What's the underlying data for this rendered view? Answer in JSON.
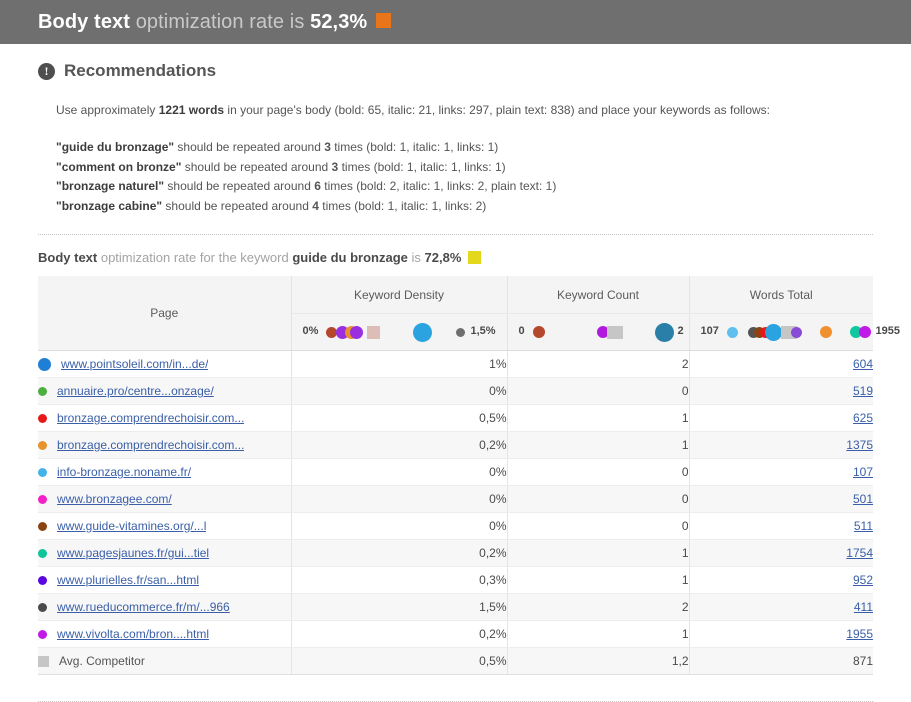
{
  "topbar": {
    "strong_1": "Body text",
    "muted_1": " optimization rate is ",
    "strong_2": "52,3%",
    "swatch_color": "#e8751a"
  },
  "recommendations": {
    "icon": "exclamation-circle-icon",
    "title": "Recommendations",
    "intro_parts": {
      "p1": "Use approximately ",
      "b1": "1221 words",
      "p2": " in your page's body (bold: 65, italic: 21, links: 297, plain text: 838) and place your keywords as follows:"
    },
    "items": [
      {
        "quote_open": "\"",
        "keyword": "guide du bronzage",
        "quote_close": "\"",
        "rest_1": " should be repeated around ",
        "count": "3",
        "rest_2": " times (bold: 1, italic: 1, links: 1)"
      },
      {
        "quote_open": "\"",
        "keyword": "comment on bronze",
        "quote_close": "\"",
        "rest_1": " should be repeated around ",
        "count": "3",
        "rest_2": " times (bold: 1, italic: 1, links: 1)"
      },
      {
        "quote_open": "\"",
        "keyword": "bronzage naturel",
        "quote_close": "\"",
        "rest_1": " should be repeated around ",
        "count": "6",
        "rest_2": " times (bold: 2, italic: 1, links: 2, plain text: 1)"
      },
      {
        "quote_open": "\"",
        "keyword": "bronzage cabine",
        "quote_close": "\"",
        "rest_1": " should be repeated around ",
        "count": "4",
        "rest_2": " times (bold: 1, italic: 1, links: 2)"
      }
    ]
  },
  "subheader": {
    "strong_1": "Body text",
    "muted_1": " optimization rate for the keyword ",
    "strong_2": "guide du bronzage",
    "muted_2": " is ",
    "strong_3": "72,8%",
    "swatch_color": "#e3d81b"
  },
  "table": {
    "headers": {
      "page": "Page",
      "keyword_density": "Keyword Density",
      "keyword_count": "Keyword Count",
      "words_total": "Words Total"
    },
    "scales": {
      "density": {
        "min_label": "0%",
        "max_label": "1,5%"
      },
      "count": {
        "min_label": "0",
        "max_label": "2"
      },
      "words": {
        "min_label": "107",
        "max_label": "1955"
      }
    },
    "rows": [
      {
        "marker": "#1f7fd4",
        "marker_size": 13,
        "marker_shape": "circle",
        "label": "www.pointsoleil.com/in...de/",
        "is_link": true,
        "density": "1%",
        "count": "2",
        "words": "604",
        "words_link": true
      },
      {
        "marker": "#4caf3f",
        "marker_size": 9,
        "marker_shape": "circle",
        "label": "annuaire.pro/centre...onzage/",
        "is_link": true,
        "density": "0%",
        "count": "0",
        "words": "519",
        "words_link": true
      },
      {
        "marker": "#e81818",
        "marker_size": 9,
        "marker_shape": "circle",
        "label": "bronzage.comprendrechoisir.com...",
        "is_link": true,
        "density": "0,5%",
        "count": "1",
        "words": "625",
        "words_link": true
      },
      {
        "marker": "#e8922c",
        "marker_size": 9,
        "marker_shape": "circle",
        "label": "bronzage.comprendrechoisir.com...",
        "is_link": true,
        "density": "0,2%",
        "count": "1",
        "words": "1375",
        "words_link": true
      },
      {
        "marker": "#44b4e8",
        "marker_size": 9,
        "marker_shape": "circle",
        "label": "info-bronzage.noname.fr/",
        "is_link": true,
        "density": "0%",
        "count": "0",
        "words": "107",
        "words_link": true
      },
      {
        "marker": "#f520c8",
        "marker_size": 9,
        "marker_shape": "circle",
        "label": "www.bronzagee.com/",
        "is_link": true,
        "density": "0%",
        "count": "0",
        "words": "501",
        "words_link": true
      },
      {
        "marker": "#8a4413",
        "marker_size": 9,
        "marker_shape": "circle",
        "label": "www.guide-vitamines.org/...l",
        "is_link": true,
        "density": "0%",
        "count": "0",
        "words": "511",
        "words_link": true
      },
      {
        "marker": "#0ec49a",
        "marker_size": 9,
        "marker_shape": "circle",
        "label": "www.pagesjaunes.fr/gui...tiel",
        "is_link": true,
        "density": "0,2%",
        "count": "1",
        "words": "1754",
        "words_link": true
      },
      {
        "marker": "#5b06e0",
        "marker_size": 9,
        "marker_shape": "circle",
        "label": "www.plurielles.fr/san...html",
        "is_link": true,
        "density": "0,3%",
        "count": "1",
        "words": "952",
        "words_link": true
      },
      {
        "marker": "#4a4a4a",
        "marker_size": 9,
        "marker_shape": "circle",
        "label": "www.rueducommerce.fr/m/...966",
        "is_link": true,
        "density": "1,5%",
        "count": "2",
        "words": "411",
        "words_link": true
      },
      {
        "marker": "#c11ae8",
        "marker_size": 9,
        "marker_shape": "circle",
        "label": "www.vivolta.com/bron....html",
        "is_link": true,
        "density": "0,2%",
        "count": "1",
        "words": "1955",
        "words_link": true
      },
      {
        "marker": "#c6c6c6",
        "marker_size": 11,
        "marker_shape": "square",
        "label": "Avg. Competitor",
        "is_link": false,
        "density": "0,5%",
        "count": "1,2",
        "words": "871",
        "words_link": false
      }
    ]
  },
  "chart_data": {
    "type": "table",
    "title": "Body text optimization rate for the keyword guide du bronzage is 72,8%",
    "categories": [
      "www.pointsoleil.com/in...de/",
      "annuaire.pro/centre...onzage/",
      "bronzage.comprendrechoisir.com...",
      "bronzage.comprendrechoisir.com...",
      "info-bronzage.noname.fr/",
      "www.bronzagee.com/",
      "www.guide-vitamines.org/...l",
      "www.pagesjaunes.fr/gui...tiel",
      "www.plurielles.fr/san...html",
      "www.rueducommerce.fr/m/...966",
      "www.vivolta.com/bron....html",
      "Avg. Competitor"
    ],
    "series": [
      {
        "name": "Keyword Density",
        "unit": "%",
        "range": [
          0,
          1.5
        ],
        "values": [
          1,
          0,
          0.5,
          0.2,
          0,
          0,
          0,
          0.2,
          0.3,
          1.5,
          0.2,
          0.5
        ]
      },
      {
        "name": "Keyword Count",
        "unit": "",
        "range": [
          0,
          2
        ],
        "values": [
          2,
          0,
          1,
          1,
          0,
          0,
          0,
          1,
          1,
          2,
          1,
          1.2
        ]
      },
      {
        "name": "Words Total",
        "unit": "",
        "range": [
          107,
          1955
        ],
        "values": [
          604,
          519,
          625,
          1375,
          107,
          501,
          511,
          1754,
          952,
          411,
          1955,
          871
        ]
      }
    ],
    "grid": false,
    "legend": "none"
  }
}
